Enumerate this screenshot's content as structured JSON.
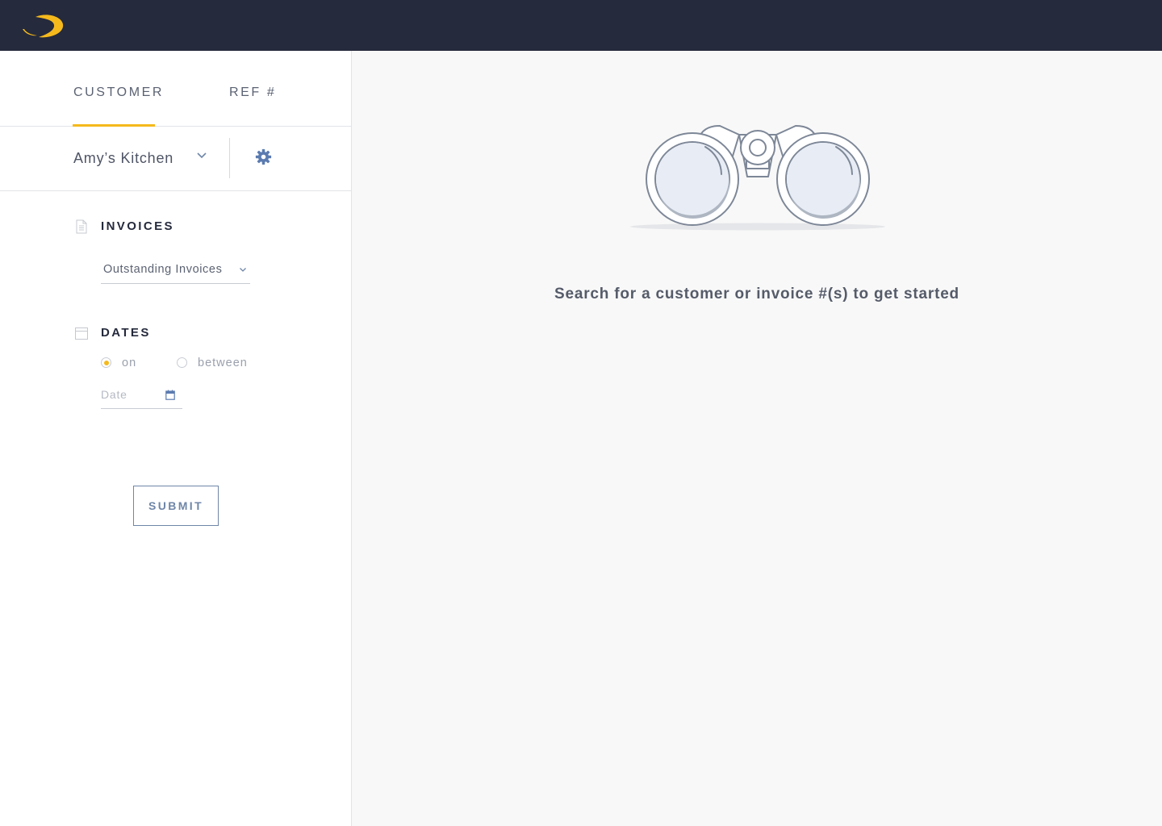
{
  "header": {
    "logo_icon": "swoosh-logo-icon",
    "brand_color": "#f5b91c",
    "background_color": "#252a3c"
  },
  "sidebar": {
    "tabs": [
      {
        "label": "CUSTOMER",
        "active": true
      },
      {
        "label": "REF #",
        "active": false
      }
    ],
    "customer": {
      "selected": "Amy’s Kitchen",
      "chevron_icon": "chevron-down-icon",
      "settings_icon": "gear-icon"
    },
    "invoices": {
      "title": "INVOICES",
      "icon": "document-icon",
      "filter_value": "Outstanding Invoices"
    },
    "dates": {
      "title": "DATES",
      "icon": "calendar-icon",
      "options": [
        {
          "label": "on",
          "selected": true
        },
        {
          "label": "between",
          "selected": false
        }
      ],
      "date_placeholder": "Date",
      "date_value": ""
    },
    "submit_label": "SUBMIT"
  },
  "main": {
    "illustration": "binoculars-icon",
    "empty_message": "Search for a customer or invoice #(s) to get started"
  }
}
